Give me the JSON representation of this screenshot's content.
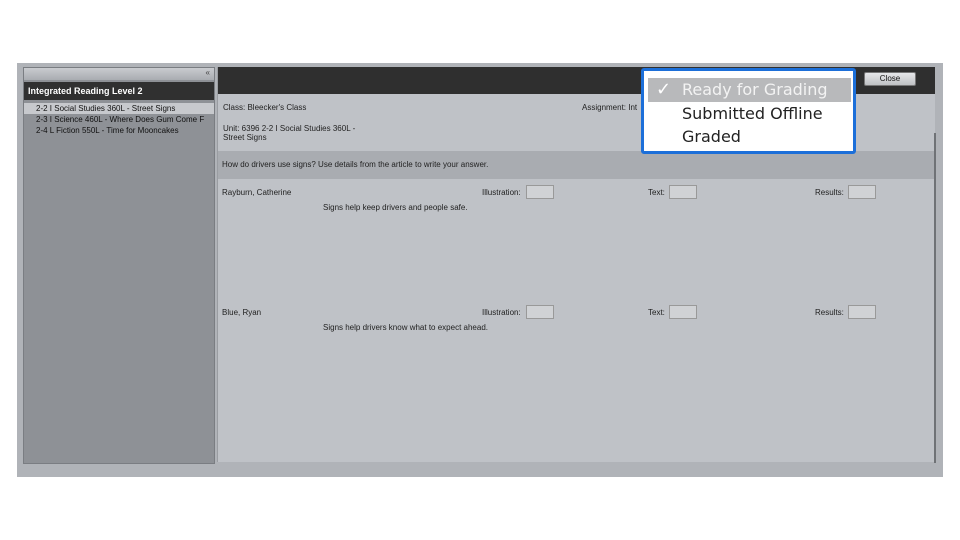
{
  "sidebar": {
    "collapse_glyph": "«",
    "header": "Integrated Reading Level 2",
    "items": [
      {
        "label": "2-2 I Social Studies 360L - Street Signs",
        "selected": true
      },
      {
        "label": "2-3 I Science 460L - Where Does Gum Come F",
        "selected": false
      },
      {
        "label": "2-4 L Fiction 550L - Time for Mooncakes",
        "selected": false
      }
    ]
  },
  "toolbar": {
    "close_label": "Close"
  },
  "info": {
    "class": "Class: Bleecker's Class",
    "assignment": "Assignment: Int",
    "unit_line1": "Unit: 6396 2-2 I Social Studies 360L -",
    "unit_line2": "Street Signs"
  },
  "question": "How do drivers use signs? Use details from the article to write your answer.",
  "score_labels": {
    "illustration": "Illustration:",
    "text": "Text:",
    "results": "Results:"
  },
  "students": [
    {
      "name": "Rayburn, Catherine",
      "answer": "Signs help keep drivers and people safe."
    },
    {
      "name": "Blue, Ryan",
      "answer": "Signs help drivers know what to expect ahead."
    }
  ],
  "status_menu": {
    "check_glyph": "✓",
    "items": [
      {
        "label": "Ready for Grading",
        "checked": true
      },
      {
        "label": "Submitted Offline",
        "checked": false
      },
      {
        "label": "Graded",
        "checked": false
      }
    ]
  },
  "colors": {
    "menu_border": "#1c6fd9",
    "topbar": "#2f2f2f",
    "sidebar_header": "#303030"
  }
}
